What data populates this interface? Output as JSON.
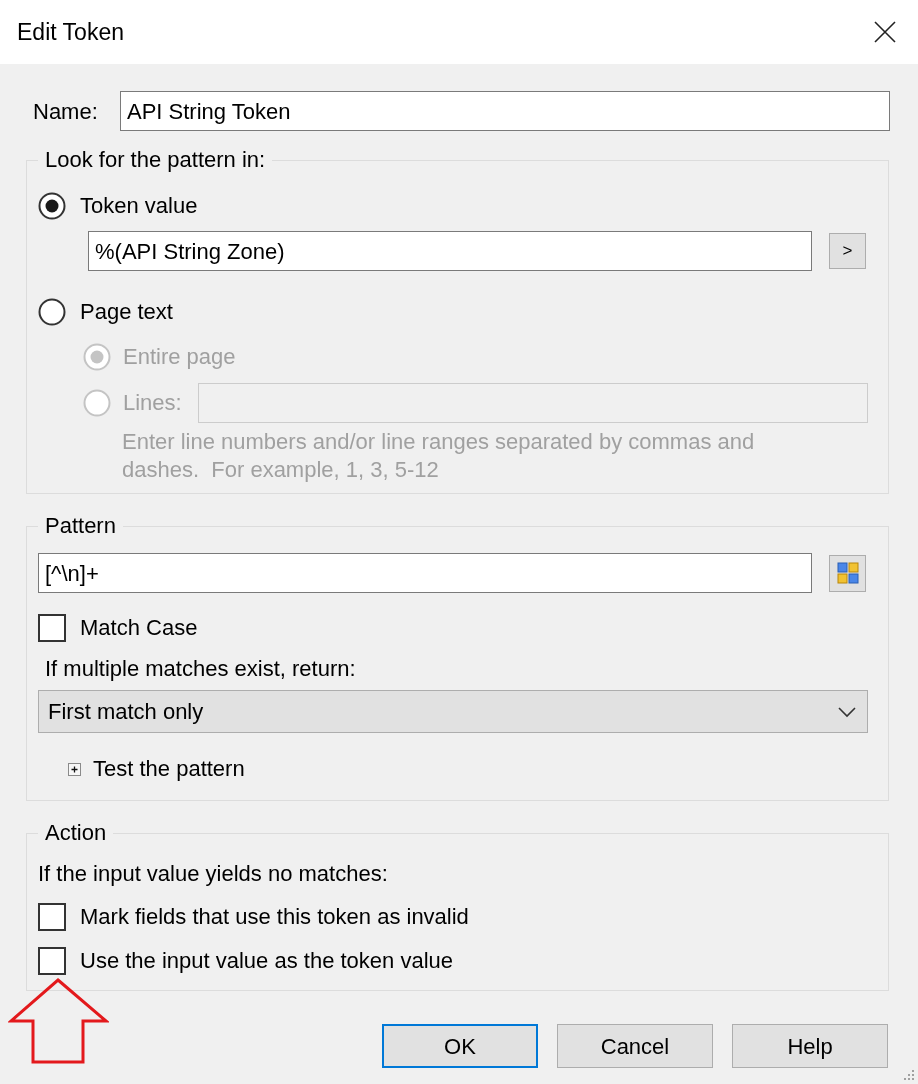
{
  "window": {
    "title": "Edit Token"
  },
  "name_field": {
    "label": "Name:",
    "value": "API String Token"
  },
  "look_for": {
    "title": "Look for the pattern in:",
    "options": [
      {
        "label": "Token value",
        "selected": true
      },
      {
        "label": "Page text",
        "selected": false
      }
    ],
    "token_value": {
      "value": "%(API String Zone)",
      "button": ">"
    },
    "page_text_options": [
      {
        "label": "Entire page",
        "selected": true,
        "disabled": true
      },
      {
        "label": "Lines:",
        "selected": false,
        "disabled": true
      }
    ],
    "lines_field": {
      "disabled": true
    },
    "hint": "Enter line numbers and/or line ranges separated by commas and dashes.  For example, 1, 3, 5-12"
  },
  "pattern": {
    "title": "Pattern",
    "value": "[^\\n]+",
    "match_case": {
      "label": "Match Case",
      "checked": false
    },
    "return_label": "If multiple matches exist, return:",
    "return_dropdown": {
      "value": "First match only"
    },
    "test_pattern": {
      "label": "Test the pattern",
      "expanded": false
    }
  },
  "action": {
    "title": "Action",
    "intro": "If the input value yields no matches:",
    "options": [
      {
        "label": "Mark fields that use this token as invalid",
        "checked": false
      },
      {
        "label": "Use the input value as the token value",
        "checked": false
      }
    ]
  },
  "buttons": [
    {
      "label": "OK",
      "default": true
    },
    {
      "label": "Cancel",
      "default": false
    },
    {
      "label": "Help",
      "default": false
    }
  ]
}
